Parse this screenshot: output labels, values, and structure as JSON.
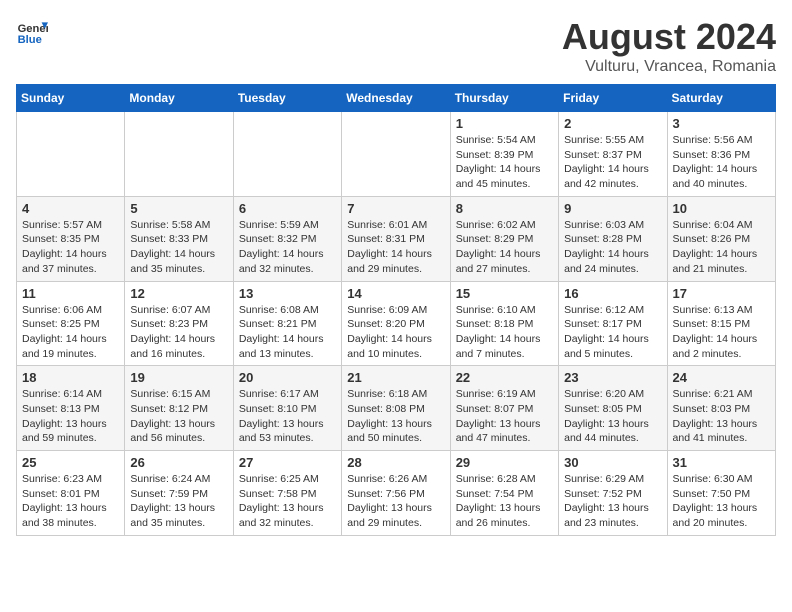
{
  "logo": {
    "text_general": "General",
    "text_blue": "Blue"
  },
  "title": "August 2024",
  "subtitle": "Vulturu, Vrancea, Romania",
  "days_of_week": [
    "Sunday",
    "Monday",
    "Tuesday",
    "Wednesday",
    "Thursday",
    "Friday",
    "Saturday"
  ],
  "weeks": [
    [
      {
        "day": "",
        "info": ""
      },
      {
        "day": "",
        "info": ""
      },
      {
        "day": "",
        "info": ""
      },
      {
        "day": "",
        "info": ""
      },
      {
        "day": "1",
        "info": "Sunrise: 5:54 AM\nSunset: 8:39 PM\nDaylight: 14 hours and 45 minutes."
      },
      {
        "day": "2",
        "info": "Sunrise: 5:55 AM\nSunset: 8:37 PM\nDaylight: 14 hours and 42 minutes."
      },
      {
        "day": "3",
        "info": "Sunrise: 5:56 AM\nSunset: 8:36 PM\nDaylight: 14 hours and 40 minutes."
      }
    ],
    [
      {
        "day": "4",
        "info": "Sunrise: 5:57 AM\nSunset: 8:35 PM\nDaylight: 14 hours and 37 minutes."
      },
      {
        "day": "5",
        "info": "Sunrise: 5:58 AM\nSunset: 8:33 PM\nDaylight: 14 hours and 35 minutes."
      },
      {
        "day": "6",
        "info": "Sunrise: 5:59 AM\nSunset: 8:32 PM\nDaylight: 14 hours and 32 minutes."
      },
      {
        "day": "7",
        "info": "Sunrise: 6:01 AM\nSunset: 8:31 PM\nDaylight: 14 hours and 29 minutes."
      },
      {
        "day": "8",
        "info": "Sunrise: 6:02 AM\nSunset: 8:29 PM\nDaylight: 14 hours and 27 minutes."
      },
      {
        "day": "9",
        "info": "Sunrise: 6:03 AM\nSunset: 8:28 PM\nDaylight: 14 hours and 24 minutes."
      },
      {
        "day": "10",
        "info": "Sunrise: 6:04 AM\nSunset: 8:26 PM\nDaylight: 14 hours and 21 minutes."
      }
    ],
    [
      {
        "day": "11",
        "info": "Sunrise: 6:06 AM\nSunset: 8:25 PM\nDaylight: 14 hours and 19 minutes."
      },
      {
        "day": "12",
        "info": "Sunrise: 6:07 AM\nSunset: 8:23 PM\nDaylight: 14 hours and 16 minutes."
      },
      {
        "day": "13",
        "info": "Sunrise: 6:08 AM\nSunset: 8:21 PM\nDaylight: 14 hours and 13 minutes."
      },
      {
        "day": "14",
        "info": "Sunrise: 6:09 AM\nSunset: 8:20 PM\nDaylight: 14 hours and 10 minutes."
      },
      {
        "day": "15",
        "info": "Sunrise: 6:10 AM\nSunset: 8:18 PM\nDaylight: 14 hours and 7 minutes."
      },
      {
        "day": "16",
        "info": "Sunrise: 6:12 AM\nSunset: 8:17 PM\nDaylight: 14 hours and 5 minutes."
      },
      {
        "day": "17",
        "info": "Sunrise: 6:13 AM\nSunset: 8:15 PM\nDaylight: 14 hours and 2 minutes."
      }
    ],
    [
      {
        "day": "18",
        "info": "Sunrise: 6:14 AM\nSunset: 8:13 PM\nDaylight: 13 hours and 59 minutes."
      },
      {
        "day": "19",
        "info": "Sunrise: 6:15 AM\nSunset: 8:12 PM\nDaylight: 13 hours and 56 minutes."
      },
      {
        "day": "20",
        "info": "Sunrise: 6:17 AM\nSunset: 8:10 PM\nDaylight: 13 hours and 53 minutes."
      },
      {
        "day": "21",
        "info": "Sunrise: 6:18 AM\nSunset: 8:08 PM\nDaylight: 13 hours and 50 minutes."
      },
      {
        "day": "22",
        "info": "Sunrise: 6:19 AM\nSunset: 8:07 PM\nDaylight: 13 hours and 47 minutes."
      },
      {
        "day": "23",
        "info": "Sunrise: 6:20 AM\nSunset: 8:05 PM\nDaylight: 13 hours and 44 minutes."
      },
      {
        "day": "24",
        "info": "Sunrise: 6:21 AM\nSunset: 8:03 PM\nDaylight: 13 hours and 41 minutes."
      }
    ],
    [
      {
        "day": "25",
        "info": "Sunrise: 6:23 AM\nSunset: 8:01 PM\nDaylight: 13 hours and 38 minutes."
      },
      {
        "day": "26",
        "info": "Sunrise: 6:24 AM\nSunset: 7:59 PM\nDaylight: 13 hours and 35 minutes."
      },
      {
        "day": "27",
        "info": "Sunrise: 6:25 AM\nSunset: 7:58 PM\nDaylight: 13 hours and 32 minutes."
      },
      {
        "day": "28",
        "info": "Sunrise: 6:26 AM\nSunset: 7:56 PM\nDaylight: 13 hours and 29 minutes."
      },
      {
        "day": "29",
        "info": "Sunrise: 6:28 AM\nSunset: 7:54 PM\nDaylight: 13 hours and 26 minutes."
      },
      {
        "day": "30",
        "info": "Sunrise: 6:29 AM\nSunset: 7:52 PM\nDaylight: 13 hours and 23 minutes."
      },
      {
        "day": "31",
        "info": "Sunrise: 6:30 AM\nSunset: 7:50 PM\nDaylight: 13 hours and 20 minutes."
      }
    ]
  ]
}
